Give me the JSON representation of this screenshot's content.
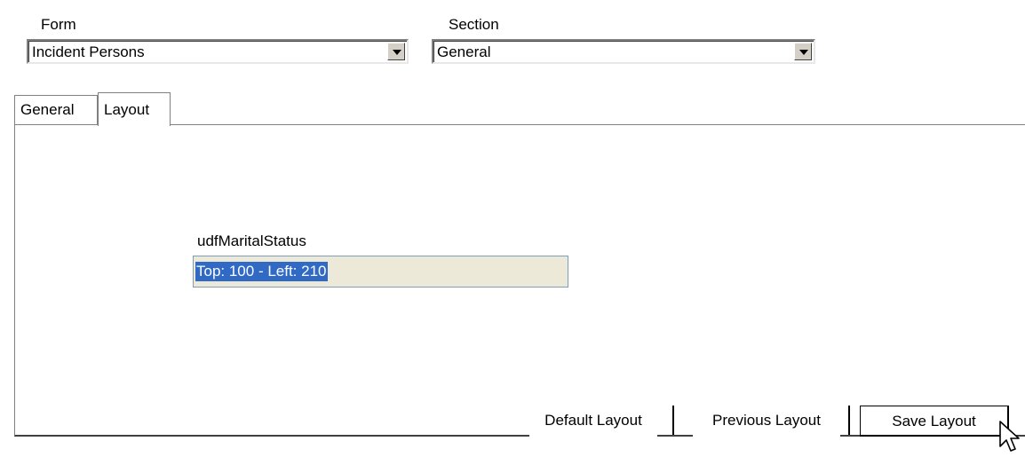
{
  "form": {
    "label": "Form",
    "value": "Incident Persons"
  },
  "section": {
    "label": "Section",
    "value": "General"
  },
  "tabs": [
    {
      "label": "General",
      "active": false
    },
    {
      "label": "Layout",
      "active": true
    }
  ],
  "field": {
    "name": "udfMaritalStatus",
    "value": "Top: 100 - Left: 210"
  },
  "buttons": {
    "default_layout": "Default Layout",
    "previous_layout": "Previous Layout",
    "save_layout": "Save Layout"
  },
  "icons": {
    "dropdown": "chevron-down-icon",
    "cursor": "mouse-pointer-icon"
  }
}
